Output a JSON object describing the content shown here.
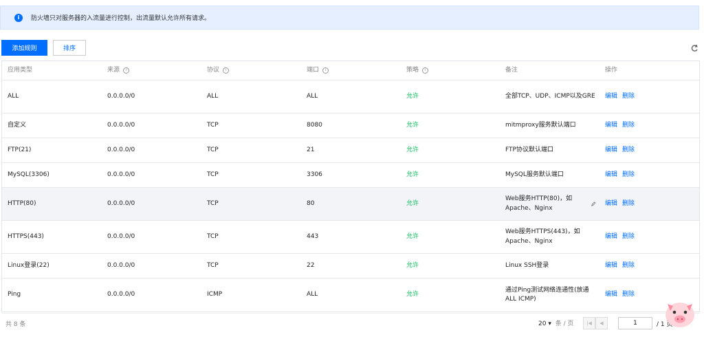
{
  "notice": {
    "text": "防火墙只对服务器的入流量进行控制，出流量默认允许所有请求。"
  },
  "toolbar": {
    "add_label": "添加规则",
    "sort_label": "排序"
  },
  "columns": [
    "应用类型",
    "来源",
    "协议",
    "端口",
    "策略",
    "备注",
    "操作"
  ],
  "rows": [
    {
      "type": "ALL",
      "source": "0.0.0.0/0",
      "protocol": "ALL",
      "port": "ALL",
      "policy": "允许",
      "note": "全部TCP、UDP、ICMP以及GRE"
    },
    {
      "type": "自定义",
      "source": "0.0.0.0/0",
      "protocol": "TCP",
      "port": "8080",
      "policy": "允许",
      "note": "mitmproxy服务默认端口"
    },
    {
      "type": "FTP(21)",
      "source": "0.0.0.0/0",
      "protocol": "TCP",
      "port": "21",
      "policy": "允许",
      "note": "FTP协议默认端口"
    },
    {
      "type": "MySQL(3306)",
      "source": "0.0.0.0/0",
      "protocol": "TCP",
      "port": "3306",
      "policy": "允许",
      "note": "MySQL服务默认端口"
    },
    {
      "type": "HTTP(80)",
      "source": "0.0.0.0/0",
      "protocol": "TCP",
      "port": "80",
      "policy": "允许",
      "note": "Web服务HTTP(80)，如Apache、Nginx"
    },
    {
      "type": "HTTPS(443)",
      "source": "0.0.0.0/0",
      "protocol": "TCP",
      "port": "443",
      "policy": "允许",
      "note": "Web服务HTTPS(443)，如Apache、Nginx"
    },
    {
      "type": "Linux登录(22)",
      "source": "0.0.0.0/0",
      "protocol": "TCP",
      "port": "22",
      "policy": "允许",
      "note": "Linux SSH登录"
    },
    {
      "type": "Ping",
      "source": "0.0.0.0/0",
      "protocol": "ICMP",
      "port": "ALL",
      "policy": "允许",
      "note": "通过Ping测试网络连通性(放通ALL ICMP)"
    }
  ],
  "actions": {
    "edit": "编辑",
    "delete": "删除"
  },
  "footer": {
    "total": "共 8 条",
    "page_size": "20",
    "page_size_unit": "条 / 页",
    "page_input": "1",
    "page_total": "/ 1 页"
  },
  "colors": {
    "primary": "#006eff",
    "allow": "#0abf5b",
    "notice_bg": "#e5efff"
  },
  "icons": {
    "info": "info-icon",
    "refresh": "refresh-icon",
    "help": "info-circle-icon",
    "edit_note": "pencil-icon",
    "mascot": "pig-mascot-icon"
  }
}
